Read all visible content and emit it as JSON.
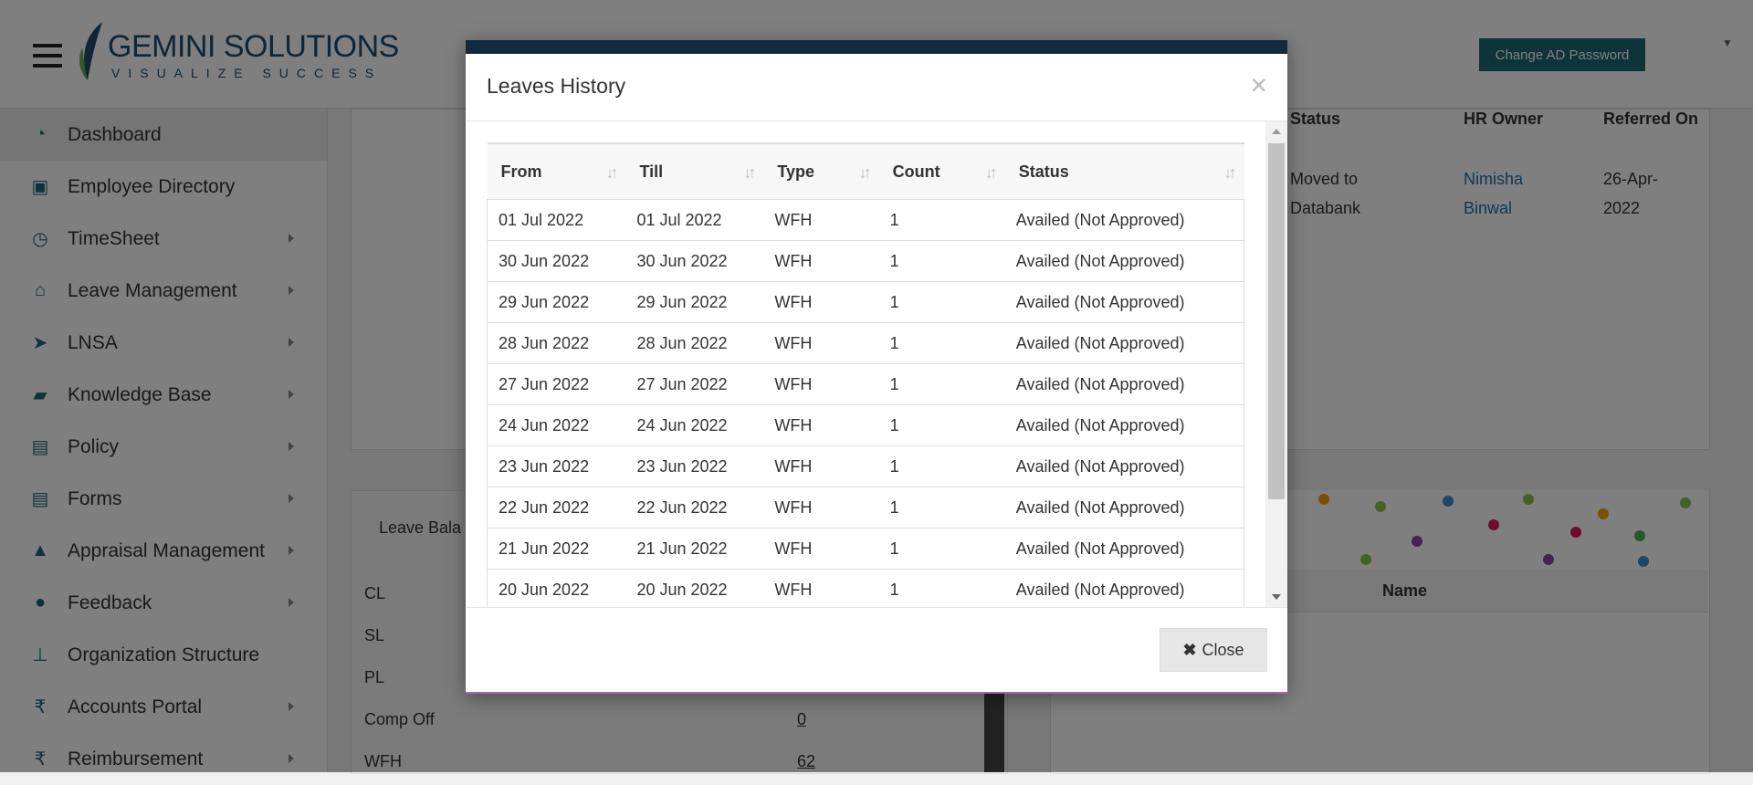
{
  "header": {
    "logo_name_bold": "GEMINI",
    "logo_name_rest": " SOLUTIONS",
    "logo_tagline": "VISUALIZE SUCCESS",
    "change_password_label": "Change AD Password"
  },
  "sidebar": {
    "items": [
      {
        "label": "Dashboard",
        "icon": "dashboard-icon",
        "has_submenu": false,
        "active": true
      },
      {
        "label": "Employee Directory",
        "icon": "contact-card-icon",
        "has_submenu": false
      },
      {
        "label": "TimeSheet",
        "icon": "clock-icon",
        "has_submenu": true
      },
      {
        "label": "Leave Management",
        "icon": "home-icon",
        "has_submenu": true
      },
      {
        "label": "LNSA",
        "icon": "paper-plane-icon",
        "has_submenu": true
      },
      {
        "label": "Knowledge Base",
        "icon": "folder-open-icon",
        "has_submenu": true
      },
      {
        "label": "Policy",
        "icon": "document-icon",
        "has_submenu": true
      },
      {
        "label": "Forms",
        "icon": "document-icon",
        "has_submenu": true
      },
      {
        "label": "Appraisal Management",
        "icon": "graduation-cap-icon",
        "has_submenu": true
      },
      {
        "label": "Feedback",
        "icon": "chat-bubbles-icon",
        "has_submenu": true
      },
      {
        "label": "Organization Structure",
        "icon": "org-chart-icon",
        "has_submenu": false
      },
      {
        "label": "Accounts Portal",
        "icon": "rupee-icon",
        "has_submenu": true
      },
      {
        "label": "Reimbursement",
        "icon": "rupee-icon",
        "has_submenu": true
      }
    ]
  },
  "referral_panel": {
    "headers": {
      "status": "Status",
      "hr_owner": "HR Owner",
      "referred_on": "Referred On"
    },
    "row": {
      "status_line1": "Moved to",
      "status_line2": "Databank",
      "hr_owner_line1": "Nimisha",
      "hr_owner_line2": "Binwal",
      "referred_on_line1": "26-Apr-",
      "referred_on_line2": "2022"
    }
  },
  "leave_panel": {
    "title": "Leave Bala",
    "rows": [
      {
        "label": "CL",
        "value": ""
      },
      {
        "label": "SL",
        "value": ""
      },
      {
        "label": "PL",
        "value": ""
      },
      {
        "label": "Comp Off",
        "value": "0"
      },
      {
        "label": "WFH",
        "value": "62"
      }
    ]
  },
  "birthday_panel": {
    "name_header": "Name"
  },
  "modal": {
    "title": "Leaves History",
    "close_x": "×",
    "close_button": "Close",
    "columns": [
      "From",
      "Till",
      "Type",
      "Count",
      "Status"
    ],
    "rows": [
      {
        "from": "01 Jul 2022",
        "till": "01 Jul 2022",
        "type": "WFH",
        "count": "1",
        "status": "Availed (Not Approved)"
      },
      {
        "from": "30 Jun 2022",
        "till": "30 Jun 2022",
        "type": "WFH",
        "count": "1",
        "status": "Availed (Not Approved)"
      },
      {
        "from": "29 Jun 2022",
        "till": "29 Jun 2022",
        "type": "WFH",
        "count": "1",
        "status": "Availed (Not Approved)"
      },
      {
        "from": "28 Jun 2022",
        "till": "28 Jun 2022",
        "type": "WFH",
        "count": "1",
        "status": "Availed (Not Approved)"
      },
      {
        "from": "27 Jun 2022",
        "till": "27 Jun 2022",
        "type": "WFH",
        "count": "1",
        "status": "Availed (Not Approved)"
      },
      {
        "from": "24 Jun 2022",
        "till": "24 Jun 2022",
        "type": "WFH",
        "count": "1",
        "status": "Availed (Not Approved)"
      },
      {
        "from": "23 Jun 2022",
        "till": "23 Jun 2022",
        "type": "WFH",
        "count": "1",
        "status": "Availed (Not Approved)"
      },
      {
        "from": "22 Jun 2022",
        "till": "22 Jun 2022",
        "type": "WFH",
        "count": "1",
        "status": "Availed (Not Approved)"
      },
      {
        "from": "21 Jun 2022",
        "till": "21 Jun 2022",
        "type": "WFH",
        "count": "1",
        "status": "Availed (Not Approved)"
      },
      {
        "from": "20 Jun 2022",
        "till": "20 Jun 2022",
        "type": "WFH",
        "count": "1",
        "status": "Availed (Not Approved)"
      }
    ]
  },
  "colors": {
    "accent": "#1a6b73",
    "brand": "#1d4c6f",
    "link": "#1a72b0",
    "modal_topbar": "#13293d"
  }
}
